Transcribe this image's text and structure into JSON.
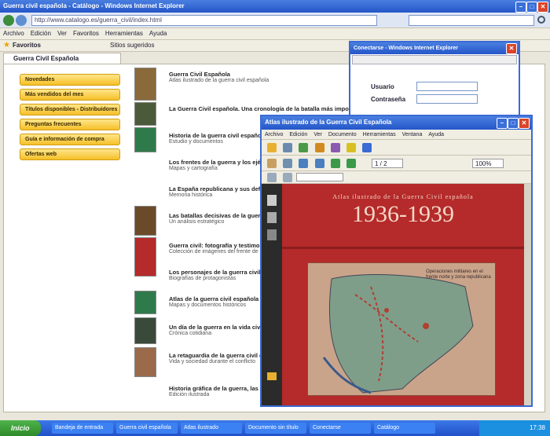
{
  "browser": {
    "title": "Guerra civil española - Catálogo - Windows Internet Explorer",
    "address": "http://www.catalogo.es/guerra_civil/index.html",
    "menu": [
      "Archivo",
      "Edición",
      "Ver",
      "Favoritos",
      "Herramientas",
      "Ayuda"
    ],
    "favorites_label": "Favoritos",
    "tab_label": "Sitios sugeridos",
    "page_tab": "Guerra Civil Española"
  },
  "sidebar": {
    "buttons": [
      "Novedades",
      "Más vendidos del mes",
      "Títulos disponibles - Distribuidores",
      "Preguntas frecuentes",
      "Guía e información de compra",
      "Ofertas web"
    ]
  },
  "entries": [
    {
      "title": "Guerra Civil Española",
      "sub": "Atlas ilustrado de la guerra civil española"
    },
    {
      "title": "La Guerra Civil española. Una cronología de la batalla más importante",
      "sub": ""
    },
    {
      "title": "Historia de la guerra civil española en imágenes",
      "sub": "Estudio y documentos"
    },
    {
      "title": "Los frentes de la guerra y los ejércitos",
      "sub": "Mapas y cartografía"
    },
    {
      "title": "La España republicana y sus defensores",
      "sub": "Memoria histórica"
    },
    {
      "title": "Las batallas decisivas de la guerra",
      "sub": "Un análisis estratégico"
    },
    {
      "title": "Guerra civil: fotografía y testimonio",
      "sub": "Colección de imágenes del frente de batalla"
    },
    {
      "title": "Los personajes de la guerra civil",
      "sub": "Biografías de protagonistas"
    },
    {
      "title": "Atlas de la guerra civil española",
      "sub": "Mapas y documentos históricos"
    },
    {
      "title": "Un día de la guerra en la vida civil",
      "sub": "Crónica cotidiana"
    },
    {
      "title": "La retaguardia de la guerra civil española",
      "sub": "Vida y sociedad durante el conflicto"
    },
    {
      "title": "Historia gráfica de la guerra, las personas y los hechos",
      "sub": "Edición ilustrada"
    }
  ],
  "login": {
    "title": "Conectarse - Windows Internet Explorer",
    "user_label": "Usuario",
    "password_label": "Contraseña"
  },
  "viewer": {
    "title": "Atlas ilustrado de la Guerra Civil Española",
    "menu": [
      "Archivo",
      "Edición",
      "Ver",
      "Documento",
      "Herramientas",
      "Ventana",
      "Ayuda"
    ],
    "zoom": "100%",
    "page": "1 / 2",
    "cover_heading": "Atlas ilustrado de la Guerra Civil española",
    "cover_years": "1936-1939",
    "map_legend": "Operaciones militares en el frente norte y zona republicana"
  },
  "taskbar": {
    "start": "Inicio",
    "items": [
      "Bandeja de entrada",
      "Guerra civil española",
      "Atlas ilustrado",
      "Documento sin título",
      "Conectarse",
      "Catálogo"
    ],
    "clock": "17:38"
  },
  "colors": {
    "cover_red": "#b52a2a",
    "sidebar_yellow": "#f5c028",
    "taskbar_blue": "#2a5fd8"
  }
}
